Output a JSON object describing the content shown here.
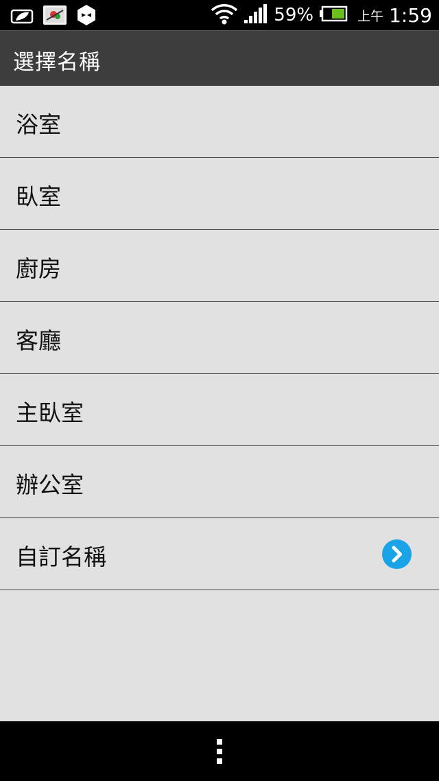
{
  "status_bar": {
    "battery_percent": "59%",
    "ampm": "上午",
    "time": "1:59",
    "icons": [
      "signal-leaf-icon",
      "app-notification-icon",
      "hexagon-app-icon",
      "wifi-icon",
      "cell-signal-icon",
      "battery-icon"
    ]
  },
  "action_bar": {
    "title": "選擇名稱"
  },
  "list": {
    "items": [
      {
        "label": "浴室"
      },
      {
        "label": "臥室"
      },
      {
        "label": "廚房"
      },
      {
        "label": "客廳"
      },
      {
        "label": "主臥室"
      },
      {
        "label": "辦公室"
      },
      {
        "label": "自訂名稱"
      }
    ]
  },
  "colors": {
    "accent_blue": "#1aa3e6",
    "battery_green": "#6abf1e"
  }
}
